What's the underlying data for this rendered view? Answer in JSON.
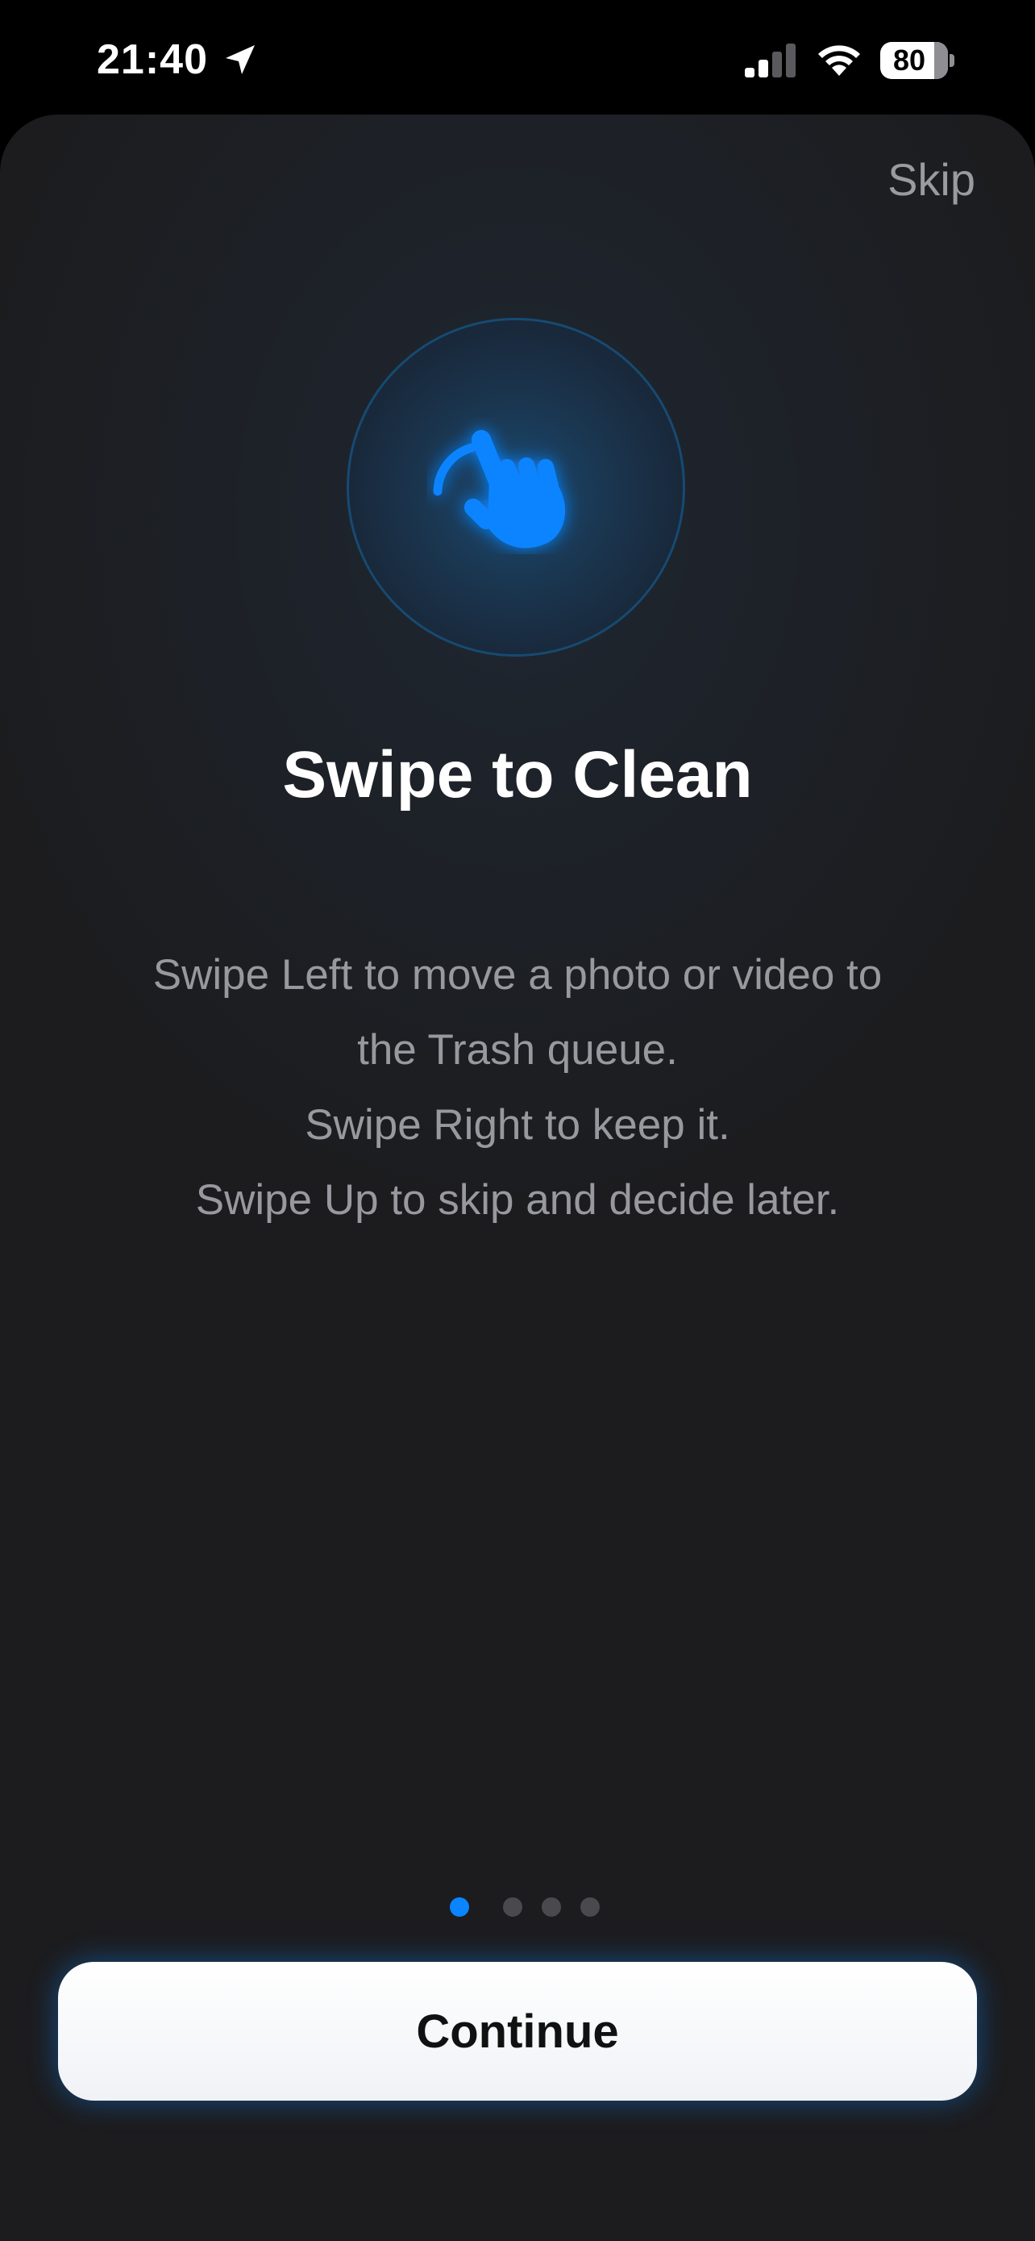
{
  "status_bar": {
    "time": "21:40",
    "battery_percent": "80",
    "battery_level": 0.8,
    "signal_bars_active": 2,
    "signal_bars_total": 4
  },
  "onboarding": {
    "skip_label": "Skip",
    "hero_icon": "hand-tap-icon",
    "title": "Swipe to Clean",
    "description_lines": [
      "Swipe Left to move a photo or video to",
      "the Trash queue.",
      "Swipe Right to keep it.",
      "Swipe Up to skip and decide later."
    ],
    "page_count": 4,
    "current_page": 1,
    "continue_label": "Continue"
  },
  "colors": {
    "accent": "#0a84ff",
    "sheet_background": "#1c1c1e",
    "secondary_text": "#98989f",
    "inactive_dot": "#4a4a4e"
  }
}
